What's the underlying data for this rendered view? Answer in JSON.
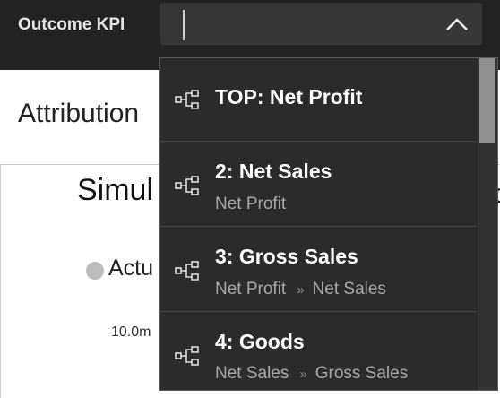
{
  "toolbar": {
    "kpi_label": "Outcome KPI",
    "select_value": ""
  },
  "background": {
    "attribution_heading": "Attribution",
    "chart_title_fragment": "Simul",
    "chart_title_right_fragment": "d",
    "legend_fragment": "Actu",
    "tick_label": "10.0m"
  },
  "dropdown": {
    "items": [
      {
        "title": "TOP: Net Profit",
        "path": []
      },
      {
        "title": "2: Net Sales",
        "path": [
          "Net Profit"
        ]
      },
      {
        "title": "3: Gross Sales",
        "path": [
          "Net Profit",
          "Net Sales"
        ]
      },
      {
        "title": "4: Goods",
        "path": [
          "Net Sales",
          "Gross Sales"
        ]
      }
    ],
    "path_separator": "»",
    "item_icon": "hierarchy-icon"
  },
  "colors": {
    "toolbar_bg": "#222222",
    "select_bg": "#373737",
    "dropdown_bg": "#2b2b2b",
    "scroll_thumb": "#8f8f8f"
  }
}
